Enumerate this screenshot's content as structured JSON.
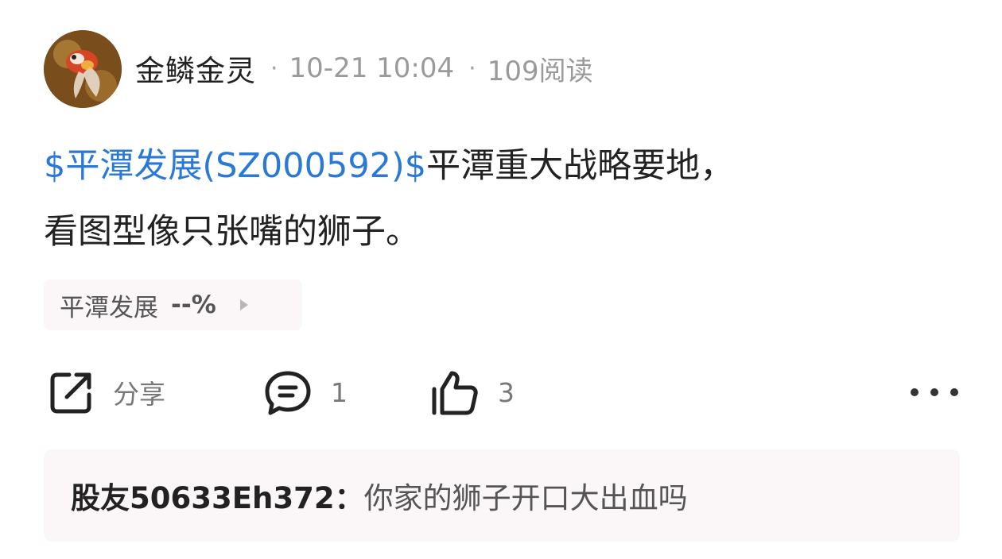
{
  "author": {
    "name": "金鳞金灵",
    "avatar_icon": "goldfish-avatar"
  },
  "meta": {
    "separator": "·",
    "time": "10-21 10:04",
    "reads": "109阅读"
  },
  "post": {
    "stock_tag": "$平潭发展(SZ000592)$",
    "text_line1": "平潭重大战略要地，",
    "text_line2": "看图型像只张嘴的狮子。",
    "link_color": "#2a79d6"
  },
  "stock_chip": {
    "name": "平潭发展",
    "change": "--%",
    "icon": "play-right-icon"
  },
  "actions": {
    "share_label": "分享",
    "share_icon": "share-icon",
    "comment_count": "1",
    "comment_icon": "comment-icon",
    "like_count": "3",
    "like_icon": "thumbs-up-icon",
    "more_icon": "more-dots-icon"
  },
  "comment_preview": {
    "user": "股友50633Eh372",
    "separator": "：",
    "text": "你家的狮子开口大出血吗"
  }
}
